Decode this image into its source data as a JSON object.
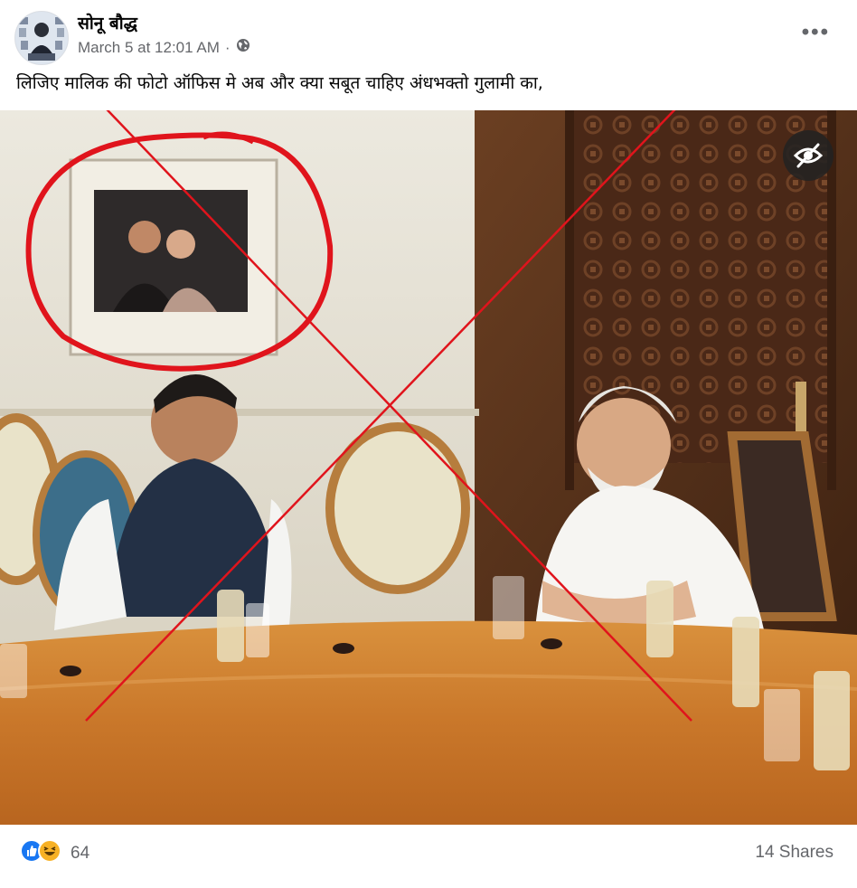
{
  "post": {
    "author": "सोनू बौद्ध",
    "timestamp": "March 5 at 12:01 AM",
    "separator": "·",
    "text": "लिजिए मालिक की फोटो ऑफिस मे अब और क्या सबूत चाहिए अंधभक्तो गुलामी का,",
    "more_label": "•••"
  },
  "engagement": {
    "reaction_count": "64",
    "shares": "14 Shares"
  },
  "icons": {
    "privacy": "globe-icon",
    "hide": "eye-slash-icon",
    "like": "like-reaction-icon",
    "haha": "haha-reaction-icon"
  },
  "colors": {
    "like_blue": "#1877f2",
    "haha_yellow": "#f7b125",
    "annotation_red": "#e0141c"
  }
}
